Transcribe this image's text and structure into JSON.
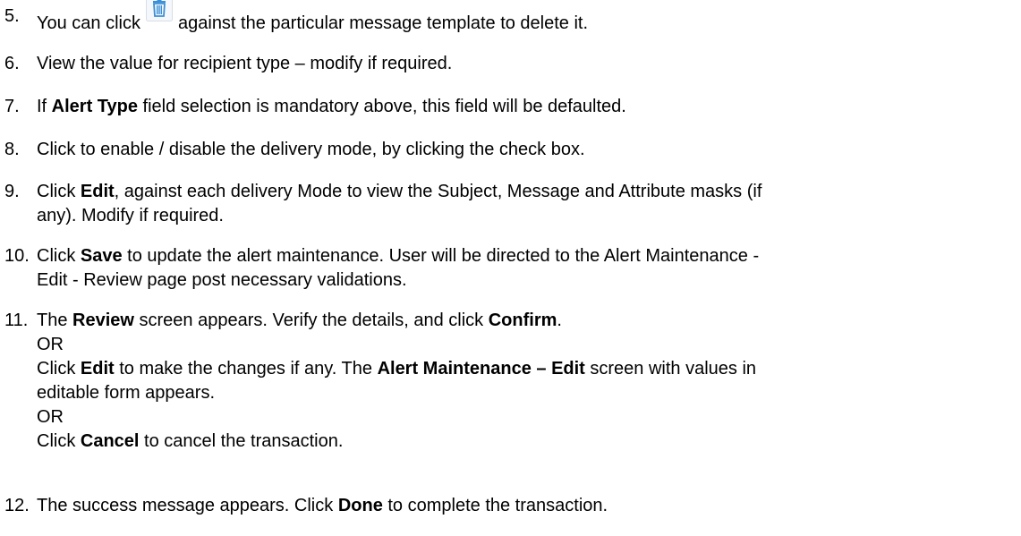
{
  "steps": [
    {
      "num": "5.",
      "parts": [
        "You can click",
        "against the particular message template to delete it."
      ],
      "icon": "trash-icon",
      "icon_color": "#3c8fd6"
    },
    {
      "num": "6.",
      "text": "View the value for recipient type – modify if required."
    },
    {
      "num": "7.",
      "parts": [
        "If ",
        "Alert Type",
        " field selection is mandatory above, this field will be defaulted."
      ]
    },
    {
      "num": "8.",
      "text": "Click to enable / disable the delivery mode, by clicking the check box."
    },
    {
      "num": "9.",
      "parts": [
        "Click ",
        "Edit",
        ", against each delivery Mode to view the Subject, Message and Attribute masks (if",
        "any). Modify if required."
      ]
    },
    {
      "num": "10.",
      "parts": [
        "Click ",
        "Save",
        " to update the alert maintenance. User will be directed to the Alert Maintenance -",
        "Edit - Review page post necessary validations."
      ]
    },
    {
      "num": "11.",
      "parts": [
        "The ",
        "Review",
        " screen appears. Verify the details, and click ",
        "Confirm",
        ".",
        "OR",
        "Click ",
        "Edit",
        " to make the changes if any. The ",
        "Alert Maintenance – Edit",
        " screen with values in",
        "editable form appears.",
        "OR",
        "Click ",
        "Cancel",
        " to cancel the transaction."
      ]
    },
    {
      "num": "12.",
      "parts": [
        "The success message appears. Click ",
        "Done",
        " to complete the transaction."
      ]
    }
  ]
}
